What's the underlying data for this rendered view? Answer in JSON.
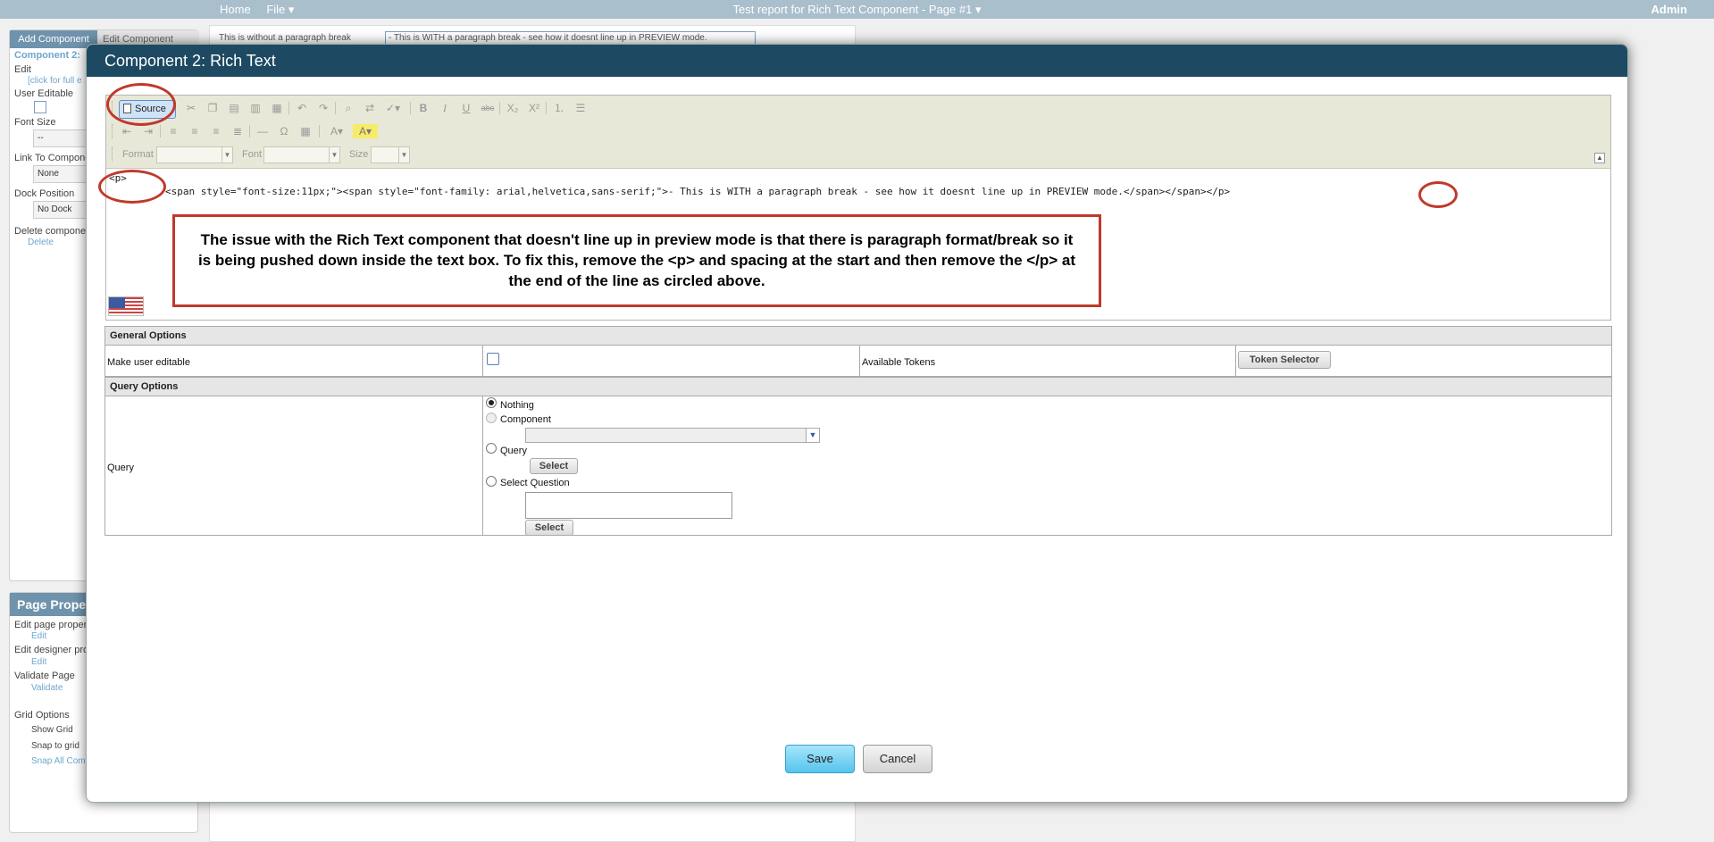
{
  "topbar": {
    "home": "Home",
    "file": "File ▾",
    "title": "Test report for Rich Text Component - Page #1 ▾",
    "user": "Admin"
  },
  "left_panel": {
    "tab_add": "Add Component",
    "tab_edit": "Edit Component",
    "component_title": "Component 2:",
    "edit_label": "Edit",
    "edit_link": "[click for full e",
    "user_editable": "User Editable",
    "font_size": "Font Size",
    "font_size_value": "--",
    "link_to": "Link To Compone",
    "link_value": "None",
    "dock_position": "Dock Position",
    "dock_value": "No Dock",
    "delete_component": "Delete componen",
    "delete_link": "Delete"
  },
  "page_panel": {
    "title": "Page Proper",
    "edit_page_props": "Edit page propert",
    "edit_link_1": "Edit",
    "edit_designer": "Edit designer pro",
    "edit_link_2": "Edit",
    "validate_page": "Validate Page",
    "validate_link": "Validate",
    "grid_options": "Grid Options",
    "show_grid": "Show Grid",
    "snap_to_grid": "Snap to grid",
    "snap_all": "Snap All Comp"
  },
  "canvas": {
    "text1": "This is without a paragraph break",
    "text2": "- This is WITH a paragraph break - see how it doesnt line up in PREVIEW mode."
  },
  "modal": {
    "title": "Component 2: Rich Text"
  },
  "editor": {
    "source_label": "Source",
    "format_label": "Format",
    "font_label": "Font",
    "size_label": "Size",
    "code_line1": "<p>",
    "code_line2": "<span style=\"font-size:11px;\"><span style=\"font-family: arial,helvetica,sans-serif;\">- This is WITH a paragraph break - see how it doesnt line up in PREVIEW mode.</span></span></p>",
    "note": "The issue with the Rich Text component that doesn't line up in preview mode is that there is paragraph format/break so it is being pushed down inside the text box. To fix this, remove the <p> and spacing at the start and then remove the </p> at the end of the line as circled above."
  },
  "general_options": {
    "heading": "General Options",
    "make_user_editable": "Make user editable",
    "available_tokens": "Available Tokens",
    "token_selector": "Token Selector"
  },
  "query_options": {
    "heading": "Query Options",
    "query_label": "Query",
    "opt_nothing": "Nothing",
    "opt_component": "Component",
    "opt_query": "Query",
    "select_btn_1": "Select",
    "opt_select_question": "Select Question",
    "select_btn_2": "Select"
  },
  "footer": {
    "save": "Save",
    "cancel": "Cancel"
  }
}
